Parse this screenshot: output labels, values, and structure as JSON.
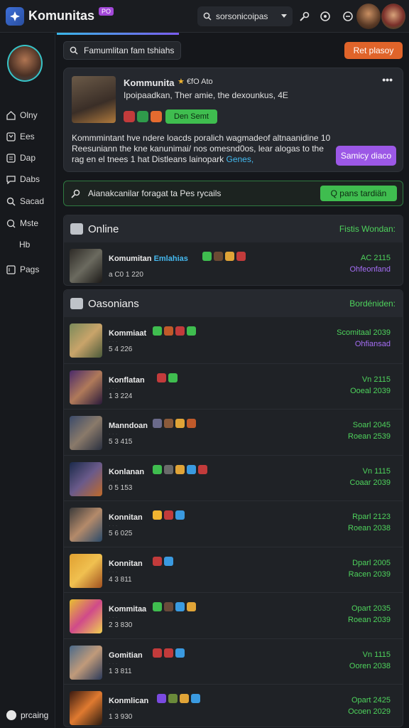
{
  "app": {
    "title": "Komunitas",
    "tag": "PO"
  },
  "search": {
    "value": "sorsonicoipas"
  },
  "header": {
    "accent": "#e0642a"
  },
  "sidebar": {
    "items": [
      {
        "label": "Olny",
        "icon": "home-icon"
      },
      {
        "label": "Ees",
        "icon": "user-icon"
      },
      {
        "label": "Dap",
        "icon": "grid-icon"
      },
      {
        "label": "Dabs",
        "icon": "chat-icon"
      },
      {
        "label": "Sacad",
        "icon": "search-icon"
      },
      {
        "label": "Mste",
        "icon": "message-icon"
      },
      {
        "label": "Hb",
        "icon": ""
      },
      {
        "label": "Pags",
        "icon": "page-icon"
      }
    ],
    "footer": "prcaing"
  },
  "main": {
    "search_label": "Famumlitan fam tshiahs",
    "action_button": "Ret plasoy"
  },
  "profile": {
    "name": "Kommunita",
    "badge": "€fO Ato",
    "desc": "Ipoipaadkan, Ther amie, the dexounkus, 4E",
    "pill": "Den Semt",
    "body_1": "Kommmintant hve ndere loacds poralich wagmadeof altnaanidine 10 Reesuniann the kne kanunimai/ nos omesnd0os, lear alogas to the rag en el tnees 1 hat Distleans lainopark",
    "body_hl": "Genes,",
    "button": "Samicy diaco"
  },
  "notice": {
    "text": "Aianakcanilar foragat ta Pes rycails",
    "button": "Q pans tardiän"
  },
  "online": {
    "title": "Online",
    "right": "Fistis Wondan:",
    "row": {
      "name": "Komumitan",
      "sub": "Emlahias",
      "meta": "a C0 1 220",
      "g1": "AC 2115",
      "g2": "Ohfeonfand"
    }
  },
  "list": {
    "title": "Oasonians",
    "right": "Bordéniden:",
    "rows": [
      {
        "name": "Kommiaat",
        "meta": "5 4 226",
        "g1": "Scomitaal 2039",
        "g2": "Ohfiansad",
        "g2_purple": true
      },
      {
        "name": "Konflatan",
        "meta": "1 3 224",
        "g1": "Vn 2115",
        "g2": "Ooeal 2039",
        "g2_purple": false
      },
      {
        "name": "Manndoan",
        "meta": "5 3 415",
        "g1": "Soarl 2045",
        "g2": "Roean 2539",
        "g2_purple": false
      },
      {
        "name": "Konlanan",
        "meta": "0 5 153",
        "g1": "Vn 1115",
        "g2": "Coaar 2039",
        "g2_purple": false
      },
      {
        "name": "Konnitan",
        "meta": "5 6 025",
        "g1": "Rparl 2123",
        "g2": "Roean 2038",
        "g2_purple": false
      },
      {
        "name": "Konnitan",
        "meta": "4 3 811",
        "g1": "Dparl 2005",
        "g2": "Racen 2039",
        "g2_purple": false
      },
      {
        "name": "Kommitaa",
        "meta": "2 3 830",
        "g1": "Opart 2035",
        "g2": "Roean 2039",
        "g2_purple": false
      },
      {
        "name": "Gomitian",
        "meta": "1 3 811",
        "g1": "Vn 1115",
        "g2": "Ooren 2038",
        "g2_purple": false
      },
      {
        "name": "Konmlican",
        "meta": "1 3 930",
        "g1": "Opart 2425",
        "g2": "Ocoen 2029",
        "g2_purple": false
      }
    ]
  }
}
